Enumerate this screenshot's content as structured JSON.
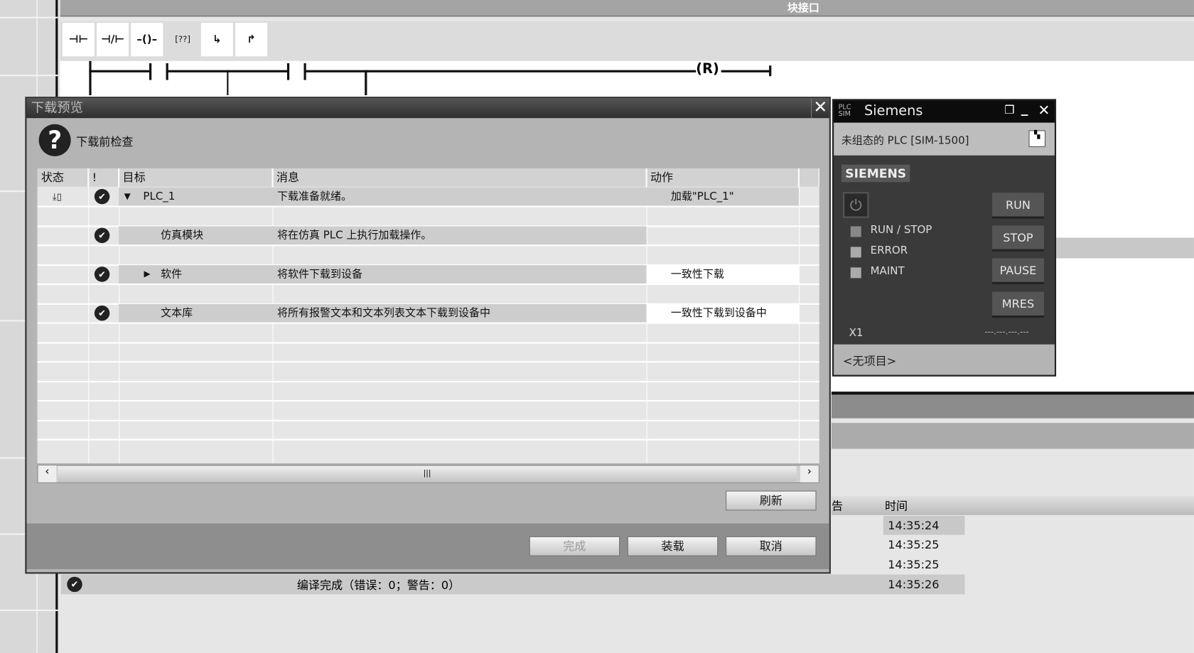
{
  "editor": {
    "block_interface": "块接口",
    "toolbar": [
      {
        "icon": "normally-open-contact-icon",
        "glyph": "⊣⊢"
      },
      {
        "icon": "normally-closed-contact-icon",
        "glyph": "⊣/⊢"
      },
      {
        "icon": "coil-icon",
        "glyph": "–()–"
      },
      {
        "icon": "empty-box-icon",
        "glyph": "[??]"
      },
      {
        "icon": "open-branch-icon",
        "glyph": "↳"
      },
      {
        "icon": "close-branch-icon",
        "glyph": "↱"
      }
    ],
    "coil_label": "R"
  },
  "dialog": {
    "title": "下载预览",
    "heading": "下载前检查",
    "columns": [
      "状态",
      "!",
      "目标",
      "消息",
      "动作"
    ],
    "rows": [
      {
        "target": "PLC_1",
        "expander": "▼",
        "message": "下载准备就绪。",
        "action": "加载\"PLC_1\""
      },
      {
        "target": "仿真模块",
        "expander": "",
        "message": "将在仿真 PLC 上执行加载操作。",
        "action": ""
      },
      {
        "target": "软件",
        "expander": "▶",
        "message": "将软件下载到设备",
        "action": "一致性下载"
      },
      {
        "target": "文本库",
        "expander": "",
        "message": "将所有报警文本和文本列表文本下载到设备中",
        "action": "一致性下载到设备中"
      }
    ],
    "refresh": "刷新",
    "finish": "完成",
    "load": "装载",
    "cancel": "取消"
  },
  "plcsim": {
    "title": "Siemens",
    "logo": "PLC SIM",
    "plc_name": "未组态的 PLC [SIM-1500]",
    "brand": "SIEMENS",
    "leds": [
      "RUN / STOP",
      "ERROR",
      "MAINT"
    ],
    "buttons": [
      "RUN",
      "STOP",
      "PAUSE",
      "MRES"
    ],
    "slot": "X1",
    "address": "---.---.---.---",
    "project": "<无项目>"
  },
  "messages": {
    "col_warning": "告",
    "col_time": "时间",
    "times": [
      "14:35:24",
      "14:35:25",
      "14:35:25",
      "14:35:26"
    ],
    "last_message": "编译完成（错误：0；警告：0）"
  }
}
